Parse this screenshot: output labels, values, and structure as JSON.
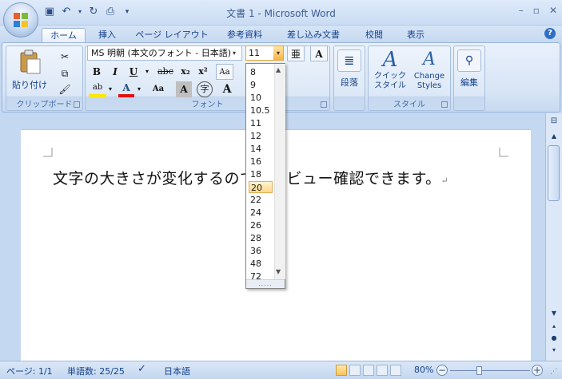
{
  "window": {
    "title": "文書 1 - Microsoft Word",
    "controls": {
      "minimize": "–",
      "maximize": "▫",
      "close": "✕"
    }
  },
  "quick_access": {
    "save": "save-icon",
    "undo": "undo-icon",
    "redo": "redo-icon",
    "print": "print-icon",
    "customize": "chevron-down-icon"
  },
  "tabs": [
    "ホーム",
    "挿入",
    "ページ レイアウト",
    "参考資料",
    "差し込み文書",
    "校閲",
    "表示"
  ],
  "help_label": "?",
  "ribbon": {
    "clipboard": {
      "paste_label": "貼り付け",
      "group_label": "クリップボード"
    },
    "font": {
      "font_name": "MS 明朝 (本文のフォント - 日本語)",
      "font_size": "11",
      "bold": "B",
      "italic": "I",
      "underline": "U",
      "strike": "abc",
      "subscript": "x₂",
      "superscript": "x²",
      "clear_format": "Aa",
      "highlight": "ab",
      "font_color": "A",
      "change_case": "Aa",
      "char_shade": "A",
      "enclosed": "字",
      "grow": "A",
      "group_label": "フォント"
    },
    "paragraph": {
      "label": "段落"
    },
    "styles": {
      "quick_styles": "クイック スタイル",
      "change_styles_1": "Change",
      "change_styles_2": "Styles",
      "group_label": "スタイル"
    },
    "editing": {
      "label": "編集"
    }
  },
  "document": {
    "text": "文字の大きさが変化するのでプレビュー確認できます。",
    "paragraph_mark": "↵"
  },
  "font_size_dropdown": {
    "options": [
      "8",
      "9",
      "10",
      "10.5",
      "11",
      "12",
      "14",
      "16",
      "18",
      "20",
      "22",
      "24",
      "26",
      "28",
      "36",
      "48",
      "72"
    ],
    "highlighted": "20",
    "grip": "....."
  },
  "statusbar": {
    "page": "ページ: 1/1",
    "word_count": "単語数: 25/25",
    "language": "日本語",
    "zoom": "80%",
    "zoom_out": "−",
    "zoom_in": "+"
  }
}
